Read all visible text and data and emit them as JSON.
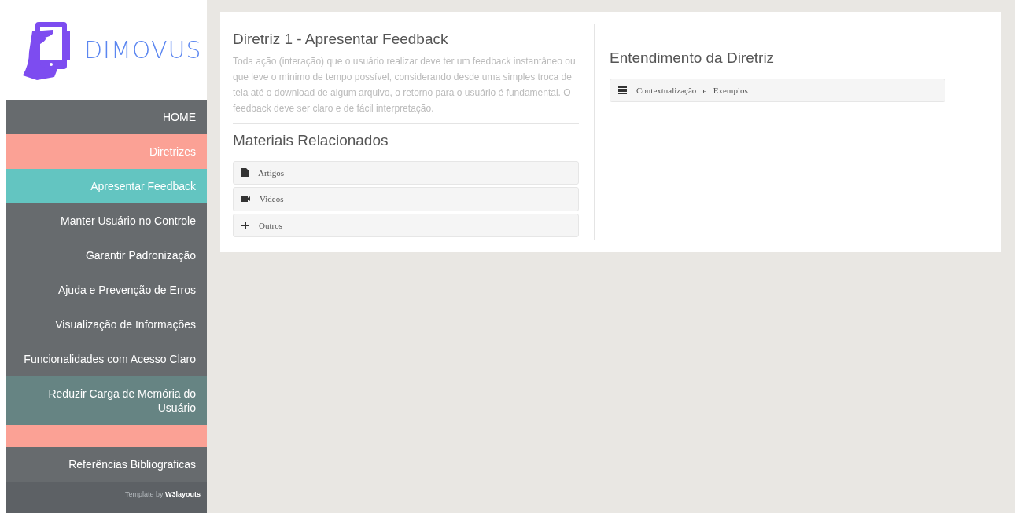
{
  "brand": {
    "name": "DIMOVUS"
  },
  "sidebar": {
    "items": [
      {
        "label": "HOME",
        "kind": "item",
        "color": "#676b6e"
      },
      {
        "label": "Diretrizes",
        "kind": "item",
        "color": "#fba195"
      },
      {
        "label": "Apresentar Feedback",
        "kind": "item",
        "color": "#63c5c1"
      },
      {
        "label": "Manter Usuário no Controle",
        "kind": "item",
        "color": "#676b6e"
      },
      {
        "label": "Garantir Padronização",
        "kind": "item",
        "color": "#676b6e"
      },
      {
        "label": "Ajuda e Prevenção de Erros",
        "kind": "item",
        "color": "#676b6e"
      },
      {
        "label": "Visualização de Informações",
        "kind": "item",
        "color": "#676b6e"
      },
      {
        "label": "Funcionalidades com Acesso Claro",
        "kind": "item",
        "color": "#676b6e"
      },
      {
        "label": "Reduzir Carga de Memória do Usuário",
        "kind": "item",
        "color": "#668483"
      },
      {
        "kind": "spacer",
        "color": "#fba195"
      },
      {
        "label": "Referências Bibliograficas",
        "kind": "item",
        "color": "#676b6e"
      }
    ],
    "footer": {
      "text": "Template by",
      "link": "W3layouts"
    }
  },
  "guideline": {
    "title": "Diretriz 1 - Apresentar Feedback",
    "description": "Toda ação (interação) que o usuário realizar deve ter um feedback instantâneo ou que leve o mínimo de tempo possível, considerando desde uma simples troca de tela até o download de algum arquivo, o retorno para o usuário é fundamental. O feedback deve ser claro e de fácil interpretação."
  },
  "materials": {
    "title": "Materiais Relacionados",
    "items": [
      {
        "label": "Artigos",
        "kind": "document"
      },
      {
        "label": "Videos",
        "kind": "video"
      },
      {
        "label": "Outros",
        "kind": "plus"
      }
    ]
  },
  "understanding": {
    "title": "Entendimento da Diretriz",
    "items": [
      {
        "label": "Contextualização   e   Exemplos",
        "kind": "list"
      }
    ]
  }
}
